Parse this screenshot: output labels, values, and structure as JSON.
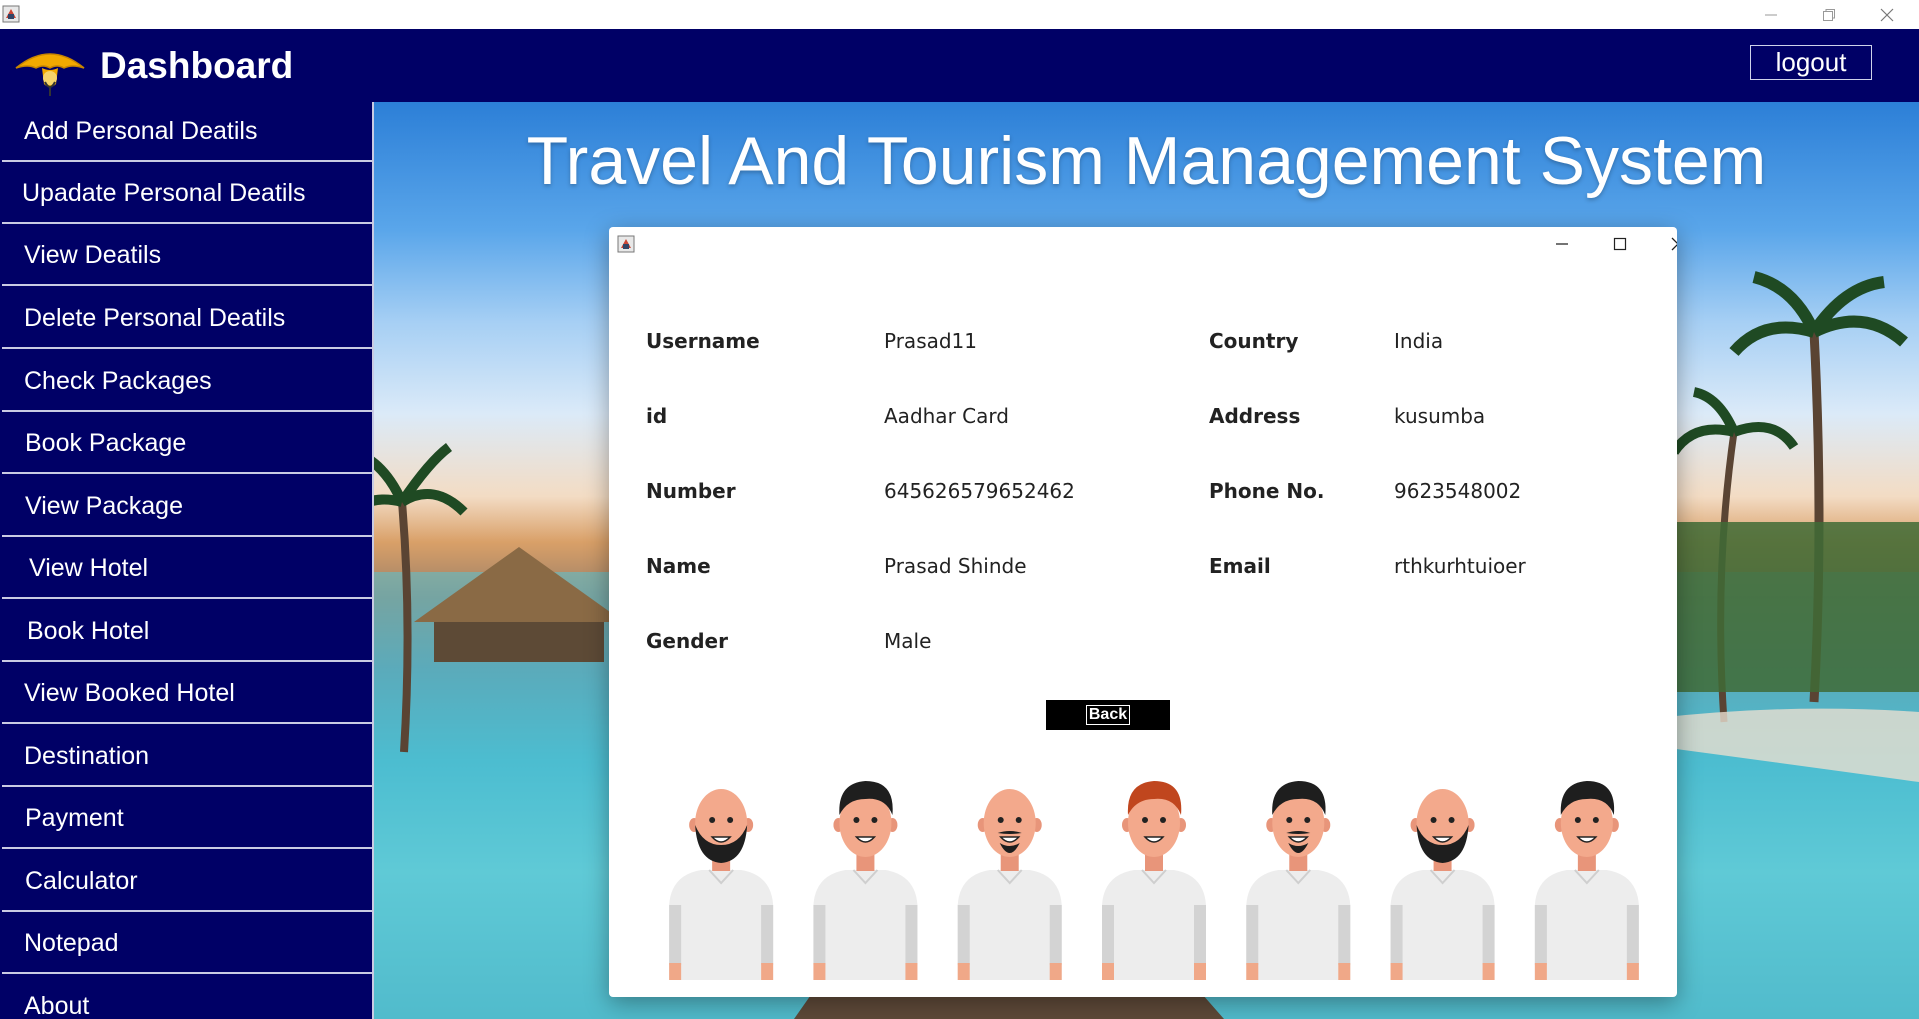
{
  "header": {
    "title": "Dashboard",
    "logout_label": "logout"
  },
  "sidebar": {
    "items": [
      {
        "label": "Add Personal Deatils"
      },
      {
        "label": "Upadate Personal Deatils"
      },
      {
        "label": "View Deatils"
      },
      {
        "label": "Delete Personal Deatils"
      },
      {
        "label": "Check Packages"
      },
      {
        "label": "Book Package"
      },
      {
        "label": "View Package"
      },
      {
        "label": "View Hotel"
      },
      {
        "label": "Book Hotel"
      },
      {
        "label": "View Booked Hotel"
      },
      {
        "label": "Destination"
      },
      {
        "label": "Payment"
      },
      {
        "label": "Calculator"
      },
      {
        "label": "Notepad"
      },
      {
        "label": "About"
      }
    ]
  },
  "main": {
    "title": "Travel And Tourism Management System"
  },
  "dialog": {
    "fields": {
      "username": {
        "label": "Username",
        "value": "Prasad11"
      },
      "id": {
        "label": "id",
        "value": "Aadhar Card"
      },
      "number": {
        "label": "Number",
        "value": "645626579652462"
      },
      "name": {
        "label": "Name",
        "value": "Prasad Shinde"
      },
      "gender": {
        "label": "Gender",
        "value": "Male"
      },
      "country": {
        "label": "Country",
        "value": "India"
      },
      "address": {
        "label": "Address",
        "value": "kusumba"
      },
      "phone": {
        "label": "Phone No.",
        "value": "9623548002"
      },
      "email": {
        "label": "Email",
        "value": "rthkurhtuioer"
      }
    },
    "back_label": "Back",
    "avatars": [
      {
        "hair": "bald",
        "beard": "full"
      },
      {
        "hair": "dark",
        "beard": "none"
      },
      {
        "hair": "bald",
        "beard": "goatee"
      },
      {
        "hair": "red",
        "beard": "none"
      },
      {
        "hair": "dark",
        "beard": "goatee"
      },
      {
        "hair": "bald",
        "beard": "full"
      },
      {
        "hair": "dark",
        "beard": "none"
      }
    ]
  },
  "icons": {
    "app": "java-app-icon",
    "minimize": "minimize-icon",
    "maximize": "maximize-icon",
    "close": "close-icon",
    "logo": "umbrella-logo-icon"
  },
  "colors": {
    "header_bg": "#000066",
    "sidebar_bg": "#000066",
    "back_button_bg": "#000000"
  }
}
